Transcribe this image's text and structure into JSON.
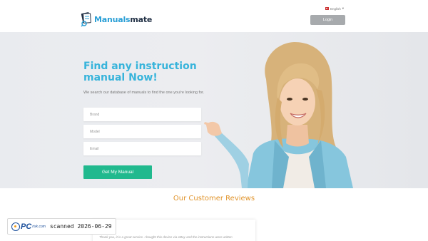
{
  "header": {
    "logo": {
      "part1": "Manuals",
      "part2": "mate"
    },
    "language": "English",
    "login_label": "Login"
  },
  "hero": {
    "title": "Find any instruction manual Now!",
    "subtitle": "We search our database of manuals to find the one you're looking for.",
    "fields": {
      "brand_placeholder": "Brand",
      "model_placeholder": "Model",
      "email_placeholder": "Email"
    },
    "cta_label": "Get My Manual"
  },
  "reviews": {
    "title": "Our Customer Reviews",
    "first_review_excerpt": "Thank you, it is a great service. I bought this device via eBay and the instructions were written"
  },
  "watermark": {
    "brand_pc": "PC",
    "brand_risk": "risk.com",
    "scanned": "scanned 2026-06-29"
  },
  "colors": {
    "brand_blue": "#2a9fd6",
    "title_blue": "#38b4db",
    "cta_green": "#21b98e",
    "reviews_orange": "#e0932a",
    "login_gray": "#a7aaad"
  }
}
